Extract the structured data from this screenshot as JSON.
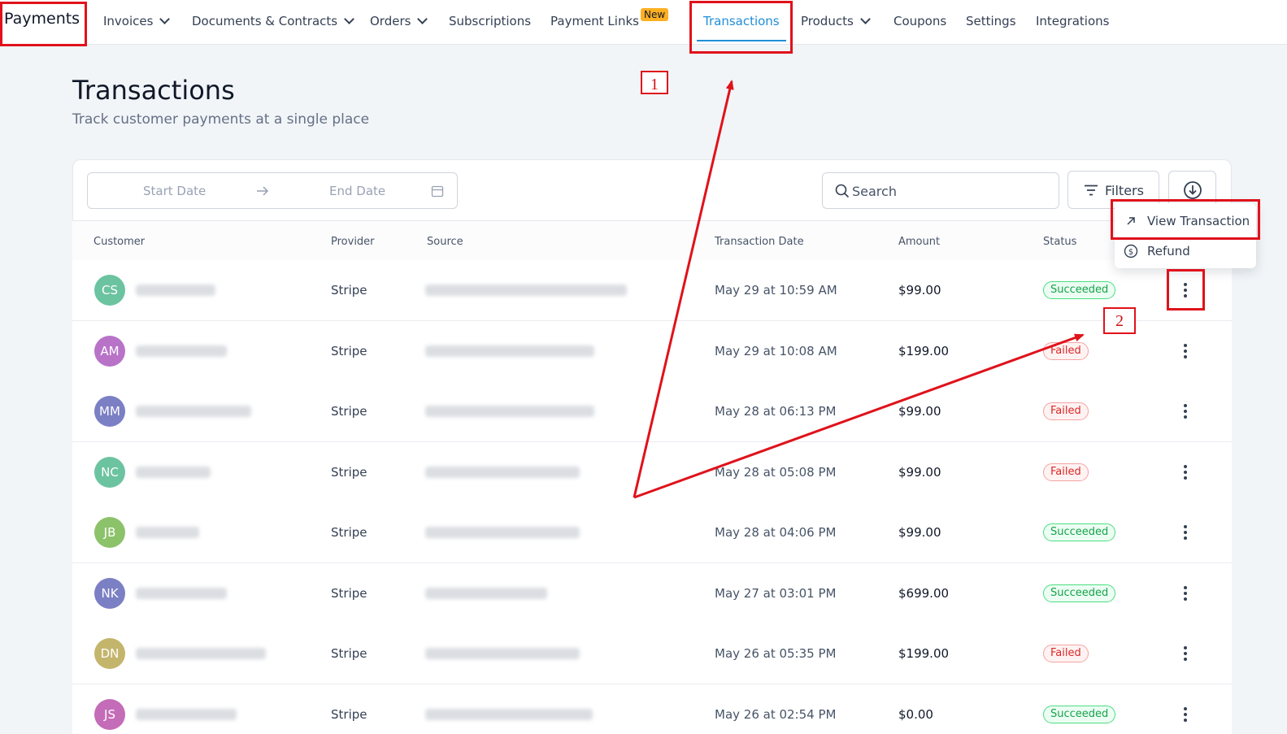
{
  "nav": {
    "brand": "Payments",
    "items": [
      {
        "label": "Invoices",
        "dropdown": true
      },
      {
        "label": "Documents & Contracts",
        "dropdown": true
      },
      {
        "label": "Orders",
        "dropdown": true
      },
      {
        "label": "Subscriptions",
        "dropdown": false
      },
      {
        "label": "Payment Links",
        "dropdown": false
      },
      {
        "label": "Transactions",
        "dropdown": false,
        "active": true
      },
      {
        "label": "Products",
        "dropdown": true
      },
      {
        "label": "Coupons",
        "dropdown": false
      },
      {
        "label": "Settings",
        "dropdown": false
      },
      {
        "label": "Integrations",
        "dropdown": false
      }
    ],
    "new_badge": "New"
  },
  "page": {
    "title": "Transactions",
    "subtitle": "Track customer payments at a single place"
  },
  "toolbar": {
    "start_date_placeholder": "Start Date",
    "end_date_placeholder": "End Date",
    "search_placeholder": "Search",
    "filters_label": "Filters"
  },
  "table": {
    "headers": [
      "Customer",
      "Provider",
      "Source",
      "Transaction Date",
      "Amount",
      "Status"
    ],
    "rows": [
      {
        "initials": "CS",
        "avatar_color": "#6cc3a0",
        "provider": "Stripe",
        "date": "May 29 at 10:59 AM",
        "amount": "$99.00",
        "status": "Succeeded"
      },
      {
        "initials": "AM",
        "avatar_color": "#b873c9",
        "provider": "Stripe",
        "date": "May 29 at 10:08 AM",
        "amount": "$199.00",
        "status": "Failed"
      },
      {
        "initials": "MM",
        "avatar_color": "#7b7fc4",
        "provider": "Stripe",
        "date": "May 28 at 06:13 PM",
        "amount": "$99.00",
        "status": "Failed"
      },
      {
        "initials": "NC",
        "avatar_color": "#6cc3a0",
        "provider": "Stripe",
        "date": "May 28 at 05:08 PM",
        "amount": "$99.00",
        "status": "Failed"
      },
      {
        "initials": "JB",
        "avatar_color": "#8cc26a",
        "provider": "Stripe",
        "date": "May 28 at 04:06 PM",
        "amount": "$99.00",
        "status": "Succeeded"
      },
      {
        "initials": "NK",
        "avatar_color": "#7b7fc4",
        "provider": "Stripe",
        "date": "May 27 at 03:01 PM",
        "amount": "$699.00",
        "status": "Succeeded"
      },
      {
        "initials": "DN",
        "avatar_color": "#c4b56c",
        "provider": "Stripe",
        "date": "May 26 at 05:35 PM",
        "amount": "$199.00",
        "status": "Failed"
      },
      {
        "initials": "JS",
        "avatar_color": "#c46cb8",
        "provider": "Stripe",
        "date": "May 26 at 02:54 PM",
        "amount": "$0.00",
        "status": "Succeeded"
      }
    ]
  },
  "row_menu": {
    "items": [
      {
        "label": "View Transaction",
        "icon": "arrow-up-right-icon"
      },
      {
        "label": "Refund",
        "icon": "dollar-circle-icon"
      }
    ]
  },
  "annotations": {
    "callout_1": "1",
    "callout_2": "2",
    "color": "#e0121b"
  }
}
